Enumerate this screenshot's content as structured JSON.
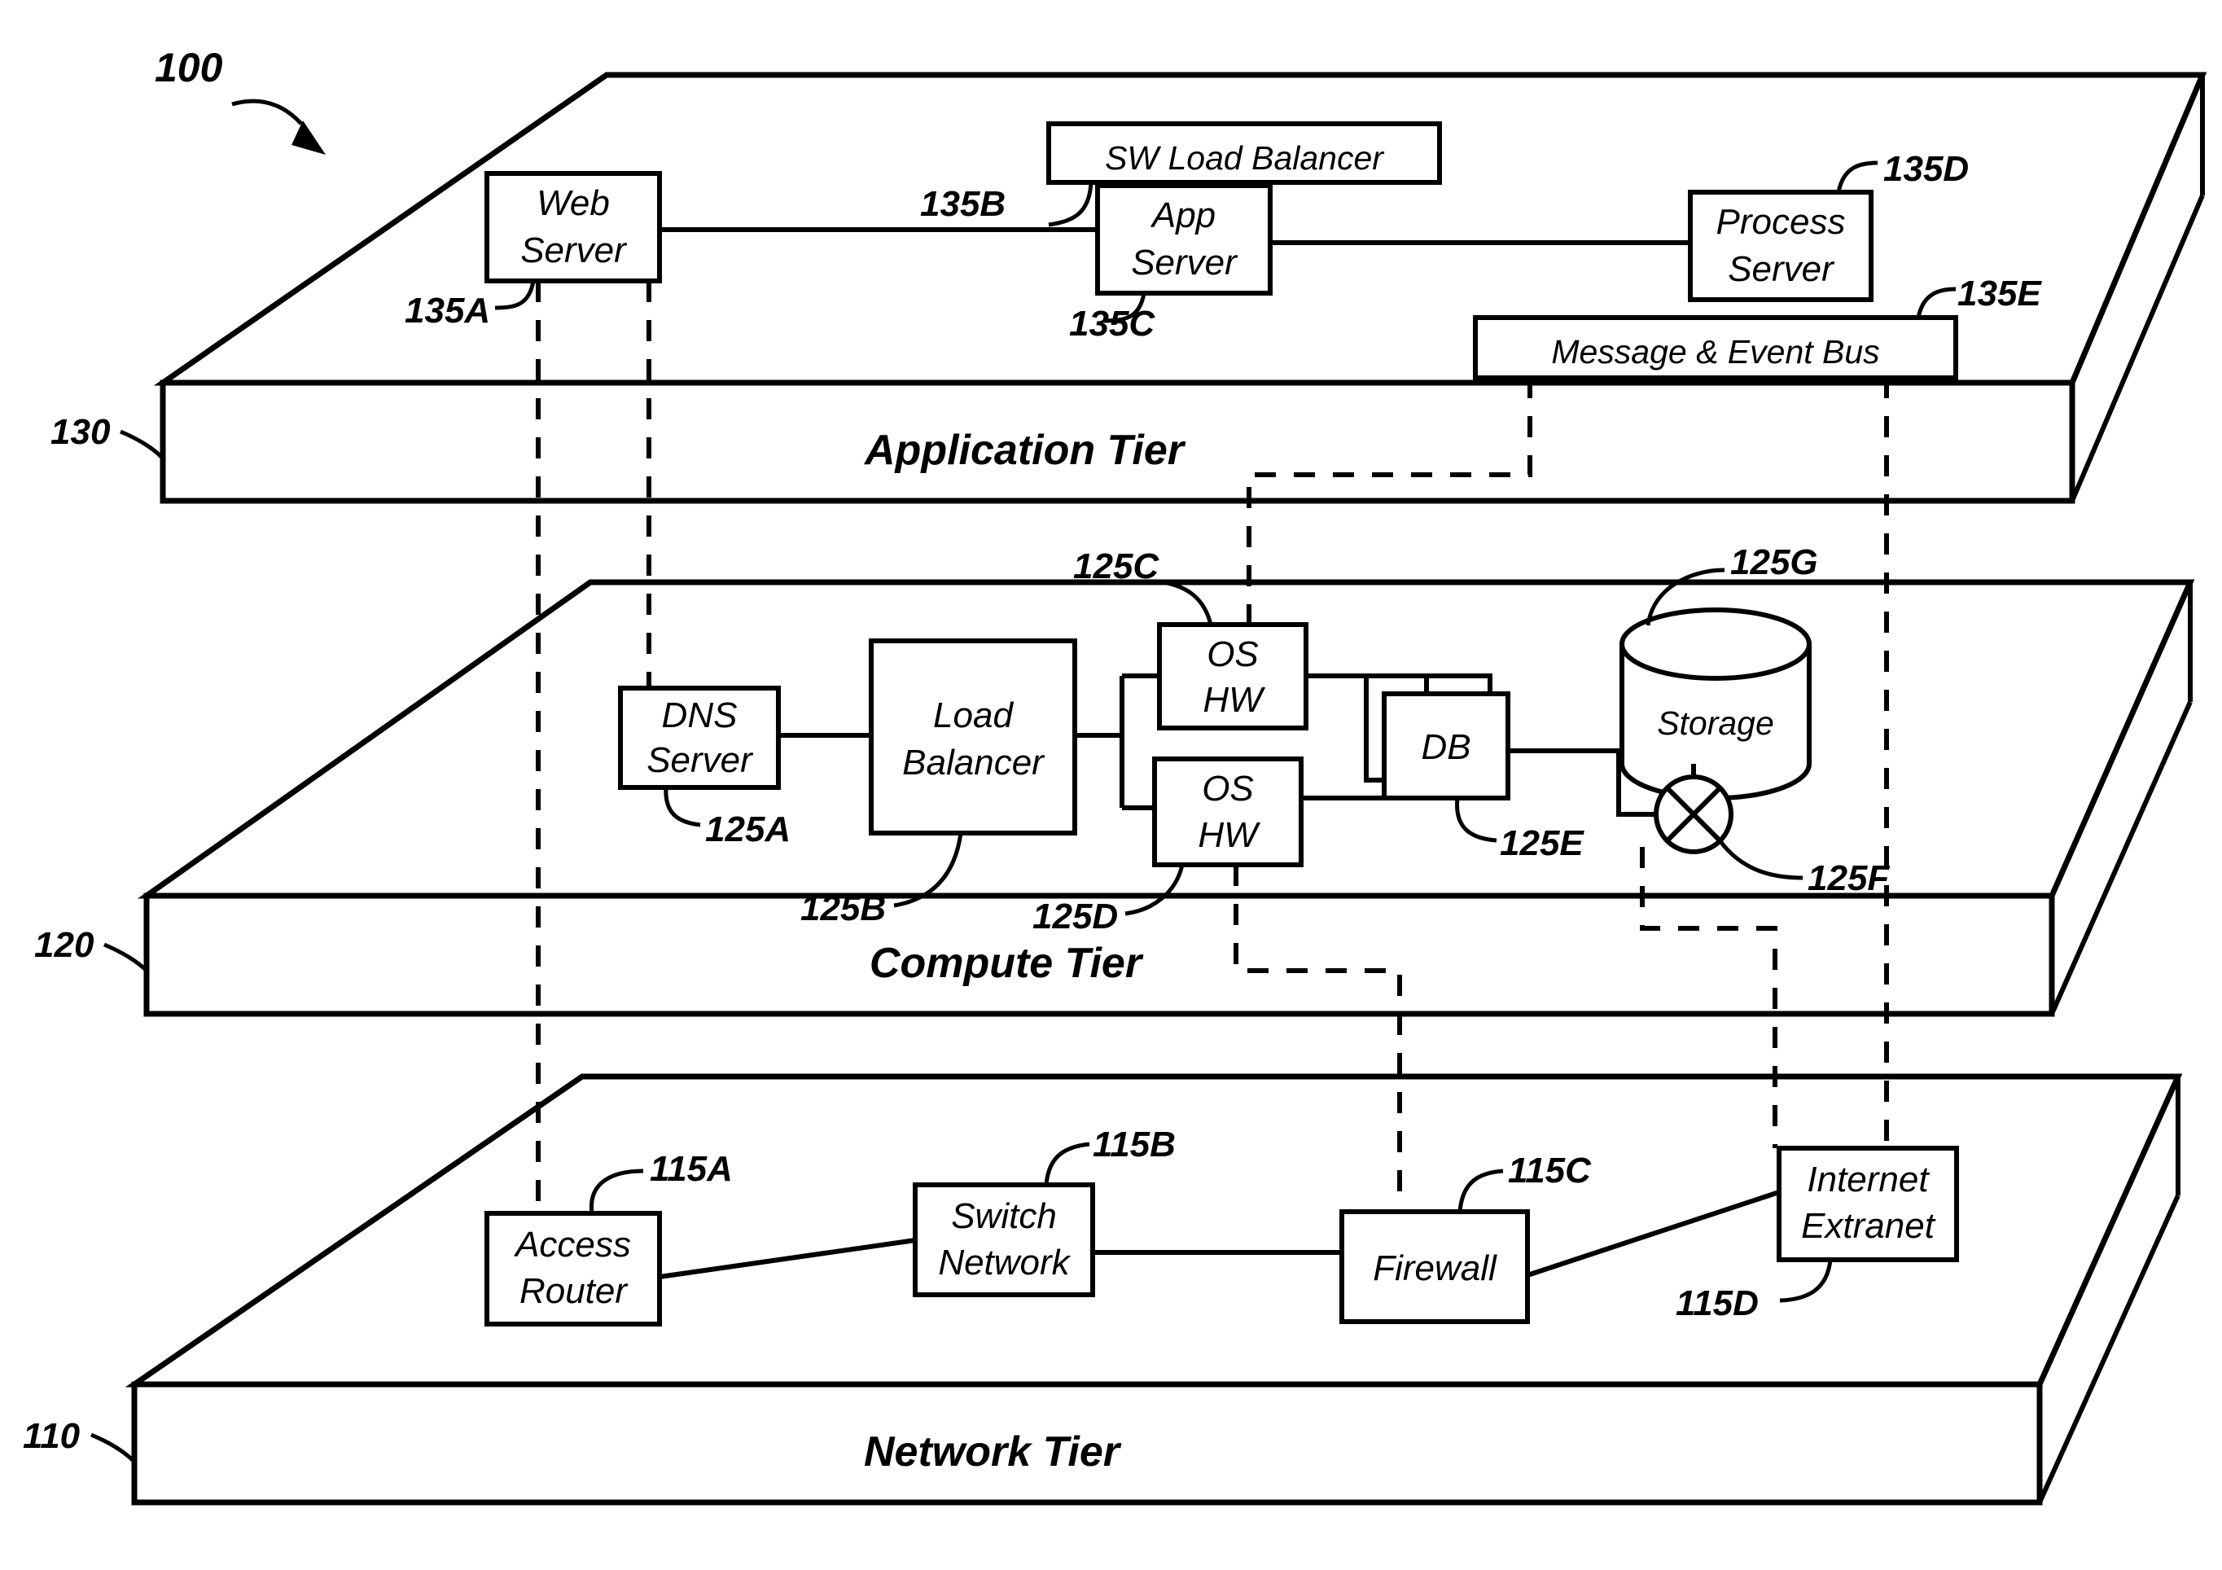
{
  "figure": {
    "number": "100",
    "type": "patent-diagram",
    "title_text": "100"
  },
  "tiers": [
    {
      "id": "application",
      "ref": "130",
      "label": "Application Tier",
      "nodes": [
        {
          "ref": "135A",
          "lines": [
            "Web",
            "Server"
          ],
          "name": "web-server"
        },
        {
          "ref": "135B",
          "lines": [
            "SW Load Balancer"
          ],
          "name": "sw-load-balancer"
        },
        {
          "ref": "135C",
          "lines": [
            "App",
            "Server"
          ],
          "name": "app-server"
        },
        {
          "ref": "135D",
          "lines": [
            "Process",
            "Server"
          ],
          "name": "process-server"
        },
        {
          "ref": "135E",
          "lines": [
            "Message & Event Bus"
          ],
          "name": "message-event-bus"
        }
      ]
    },
    {
      "id": "compute",
      "ref": "120",
      "label": "Compute Tier",
      "nodes": [
        {
          "ref": "125A",
          "lines": [
            "DNS",
            "Server"
          ],
          "name": "dns-server"
        },
        {
          "ref": "125B",
          "lines": [
            "Load",
            "Balancer"
          ],
          "name": "load-balancer"
        },
        {
          "ref": "125C",
          "lines": [
            "OS",
            "HW"
          ],
          "name": "os-hw-upper"
        },
        {
          "ref": "125D",
          "lines": [
            "OS",
            "HW"
          ],
          "name": "os-hw-lower"
        },
        {
          "ref": "125E",
          "lines": [
            "DB"
          ],
          "name": "db"
        },
        {
          "ref": "125F",
          "lines": [],
          "name": "san-switch"
        },
        {
          "ref": "125G",
          "lines": [
            "Storage"
          ],
          "name": "storage"
        }
      ]
    },
    {
      "id": "network",
      "ref": "110",
      "label": "Network Tier",
      "nodes": [
        {
          "ref": "115A",
          "lines": [
            "Access",
            "Router"
          ],
          "name": "access-router"
        },
        {
          "ref": "115B",
          "lines": [
            "Switch",
            "Network"
          ],
          "name": "switch-network"
        },
        {
          "ref": "115C",
          "lines": [
            "Firewall"
          ],
          "name": "firewall"
        },
        {
          "ref": "115D",
          "lines": [
            "Internet",
            "Extranet"
          ],
          "name": "internet-extranet"
        }
      ]
    }
  ],
  "refs": {
    "fig": "100",
    "tier_app": "130",
    "tier_compute": "120",
    "tier_network": "110",
    "r135A": "135A",
    "r135B": "135B",
    "r135C": "135C",
    "r135D": "135D",
    "r135E": "135E",
    "r125A": "125A",
    "r125B": "125B",
    "r125C": "125C",
    "r125D": "125D",
    "r125E": "125E",
    "r125F": "125F",
    "r125G": "125G",
    "r115A": "115A",
    "r115B": "115B",
    "r115C": "115C",
    "r115D": "115D"
  },
  "text": {
    "web": "Web",
    "server": "Server",
    "sw_load_balancer": "SW Load Balancer",
    "app": "App",
    "process": "Process",
    "message_event_bus": "Message & Event Bus",
    "application_tier": "Application Tier",
    "dns": "DNS",
    "load": "Load",
    "balancer": "Balancer",
    "os": "OS",
    "hw": "HW",
    "db": "DB",
    "storage": "Storage",
    "compute_tier": "Compute Tier",
    "access": "Access",
    "router": "Router",
    "switch": "Switch",
    "network": "Network",
    "firewall": "Firewall",
    "internet": "Internet",
    "extranet": "Extranet",
    "network_tier": "Network Tier"
  },
  "colors": {
    "ink": "#000000",
    "paper": "#ffffff"
  }
}
